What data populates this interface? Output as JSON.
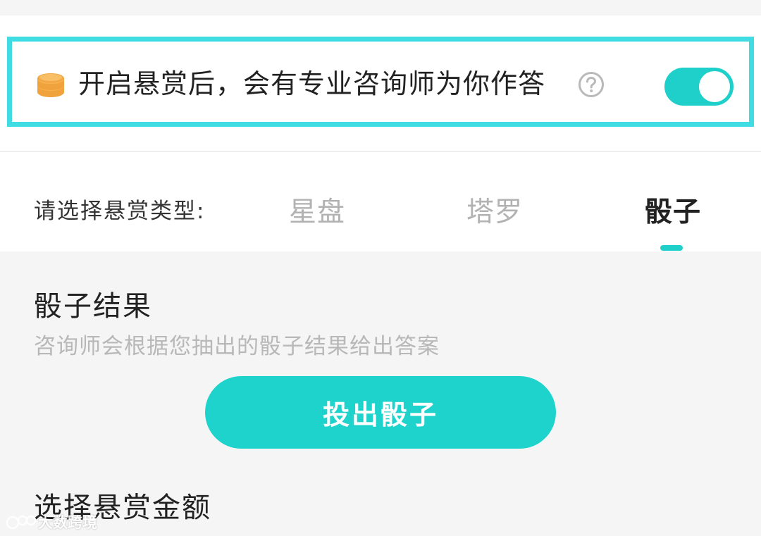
{
  "bounty": {
    "text": "开启悬赏后，会有专业咨询师为你作答",
    "coin_icon": "coin-stack-icon",
    "help_icon": "question-circle-icon",
    "toggle_on": true
  },
  "type_selector": {
    "label": "请选择悬赏类型:",
    "tabs": [
      {
        "label": "星盘",
        "active": false
      },
      {
        "label": "塔罗",
        "active": false
      },
      {
        "label": "骰子",
        "active": true
      }
    ]
  },
  "dice_section": {
    "title": "骰子结果",
    "description": "咨询师会根据您抽出的骰子结果给出答案",
    "button_label": "投出骰子"
  },
  "amount_section": {
    "title": "选择悬赏金额"
  },
  "watermark": {
    "text": "大数跨境"
  },
  "colors": {
    "accent": "#1fcfc9",
    "highlight_border": "#3fdde3",
    "coin": "#f5a843",
    "background": "#f5f5f5"
  }
}
